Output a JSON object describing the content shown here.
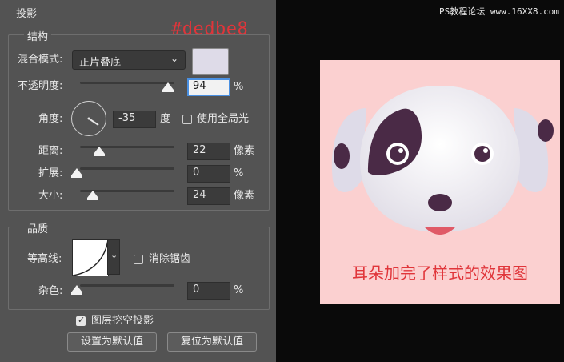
{
  "panel": {
    "title": "投影",
    "structure_title": "结构",
    "hex_annotation": "#dedbe8",
    "blend_mode_label": "混合模式:",
    "blend_mode_value": "正片叠底",
    "shadow_color": "#dedbe8",
    "opacity_label": "不透明度:",
    "opacity_value": "94",
    "opacity_unit": "%",
    "angle_label": "角度:",
    "angle_value": "-35",
    "angle_unit": "度",
    "global_light_label": "使用全局光",
    "global_light_checked": false,
    "distance_label": "距离:",
    "distance_value": "22",
    "distance_unit": "像素",
    "spread_label": "扩展:",
    "spread_value": "0",
    "spread_unit": "%",
    "size_label": "大小:",
    "size_value": "24",
    "size_unit": "像素",
    "quality_title": "品质",
    "contour_label": "等高线:",
    "antialias_label": "消除锯齿",
    "antialias_checked": false,
    "noise_label": "杂色:",
    "noise_value": "0",
    "noise_unit": "%",
    "knockout_label": "图层挖空投影",
    "knockout_checked": true,
    "set_default_button": "设置为默认值",
    "reset_default_button": "复位为默认值"
  },
  "preview": {
    "watermark": "PS教程论坛 www.16XX8.com",
    "caption": "耳朵加完了样式的效果图",
    "background": "#fbd0d0"
  }
}
